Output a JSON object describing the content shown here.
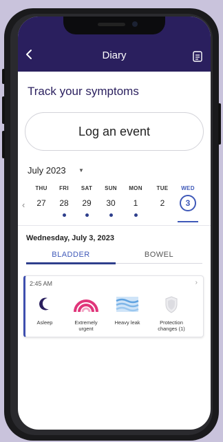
{
  "header": {
    "title": "Diary",
    "back_icon": "chevron-left-icon",
    "action_icon": "document-icon"
  },
  "main": {
    "heading": "Track your symptoms",
    "log_button": "Log an event",
    "month_label": "July 2023",
    "days": [
      {
        "dow": "THU",
        "num": "27",
        "has_event": false
      },
      {
        "dow": "FRI",
        "num": "28",
        "has_event": true
      },
      {
        "dow": "SAT",
        "num": "29",
        "has_event": true
      },
      {
        "dow": "SUN",
        "num": "30",
        "has_event": true
      },
      {
        "dow": "MON",
        "num": "1",
        "has_event": true
      },
      {
        "dow": "TUE",
        "num": "2",
        "has_event": false
      },
      {
        "dow": "WED",
        "num": "3",
        "has_event": false,
        "selected": true
      }
    ],
    "selected_date": "Wednesday, July 3, 2023",
    "tabs": [
      {
        "label": "BLADDER",
        "active": true
      },
      {
        "label": "BOWEL",
        "active": false
      }
    ],
    "entry": {
      "time": "2:45 AM",
      "items": [
        {
          "icon": "moon-icon",
          "label": "Asleep"
        },
        {
          "icon": "urgency-gauge-icon",
          "label": "Extremely urgent"
        },
        {
          "icon": "waves-icon",
          "label": "Heavy leak"
        },
        {
          "icon": "shield-icon",
          "label": "Protection changes (1)"
        }
      ]
    }
  },
  "colors": {
    "header": "#2a1f5e",
    "accent": "#3e58b8",
    "dot": "#2e3f8c",
    "urgent": "#e0357a",
    "leak": "#7fb6e8"
  }
}
